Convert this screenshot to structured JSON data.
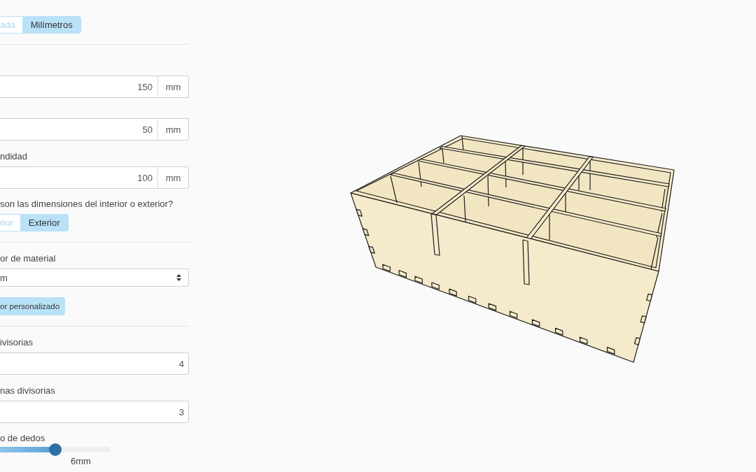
{
  "settings_panel": {
    "unit_toggle": [
      {
        "label": "ada",
        "selected": false
      },
      {
        "label": "Milímetros",
        "selected": true
      }
    ],
    "size_fields": [
      {
        "value": "150",
        "unit": "mm"
      },
      {
        "value": "50",
        "unit": "mm"
      },
      {
        "label": "ndidad",
        "value": "100",
        "unit": "mm"
      }
    ],
    "dimensions_question": "son las dimensiones del interior o exterior?",
    "dimensions_toggle": [
      {
        "label": "rior",
        "selected": false
      },
      {
        "label": "Exterior",
        "selected": true
      }
    ],
    "material_thickness": {
      "label": "or de material",
      "value": "m",
      "custom_button": "or personalizado"
    },
    "divider_fields": [
      {
        "label": "ivisorias",
        "value": "4"
      },
      {
        "label": "nas divisorias",
        "value": "3"
      }
    ],
    "finger_size": {
      "label": "o de dedos",
      "level": 0.5,
      "reading": "6mm"
    }
  }
}
